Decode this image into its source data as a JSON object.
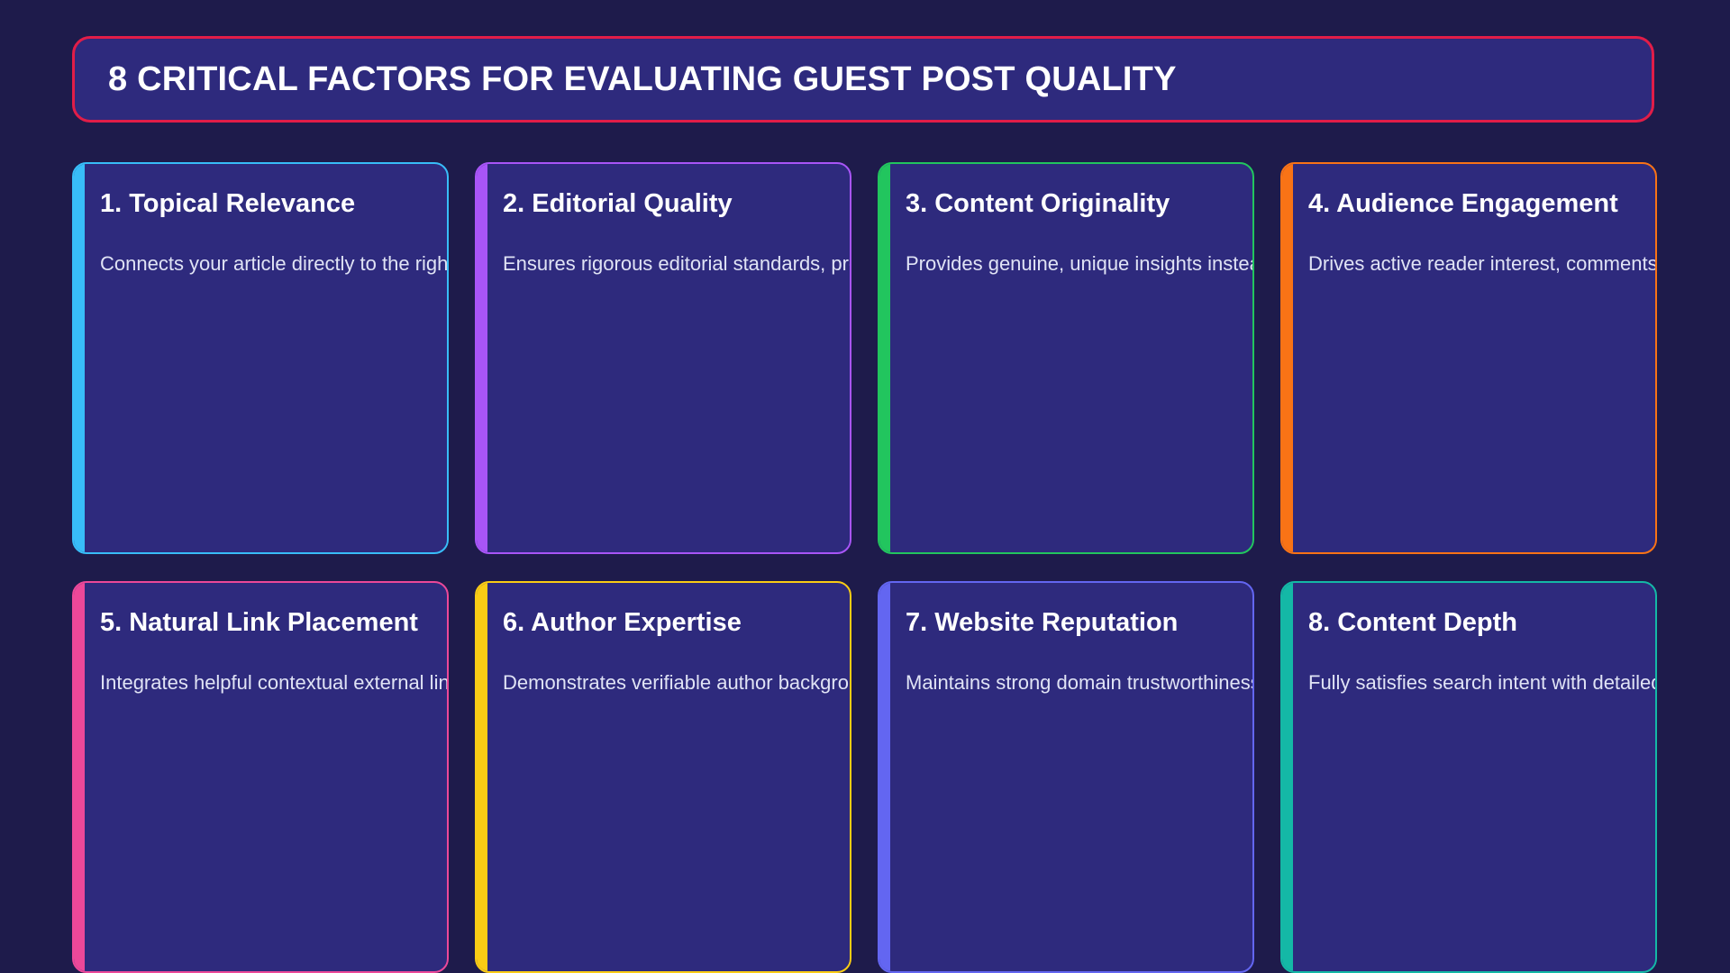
{
  "header": {
    "title": "8 CRITICAL FACTORS FOR EVALUATING GUEST POST QUALITY",
    "border_color": "#e11d48"
  },
  "background_color": "#1e1b4b",
  "card_background": "#2e2a7d",
  "cards": [
    {
      "title": "1. Topical Relevance",
      "description": "Connects your article directly to the right audience and niche",
      "color": "#38bdf8"
    },
    {
      "title": "2. Editorial Quality",
      "description": "Ensures rigorous editorial standards, proofreading and fact checks",
      "color": "#a855f7"
    },
    {
      "title": "3. Content Originality",
      "description": "Provides genuine, unique insights instead of recycled content",
      "color": "#22c55e"
    },
    {
      "title": "4. Audience Engagement",
      "description": "Drives active reader interest, comments, social shares and discussion",
      "color": "#f97316"
    },
    {
      "title": "5. Natural Link Placement",
      "description": "Integrates helpful contextual external links naturally",
      "color": "#ec4899"
    },
    {
      "title": "6. Author Expertise",
      "description": "Demonstrates verifiable author background and credentials",
      "color": "#facc15"
    },
    {
      "title": "7. Website Reputation",
      "description": "Maintains strong domain trustworthiness and authority",
      "color": "#6366f1"
    },
    {
      "title": "8. Content Depth",
      "description": "Fully satisfies search intent with detailed explanations",
      "color": "#14b8a6"
    }
  ]
}
